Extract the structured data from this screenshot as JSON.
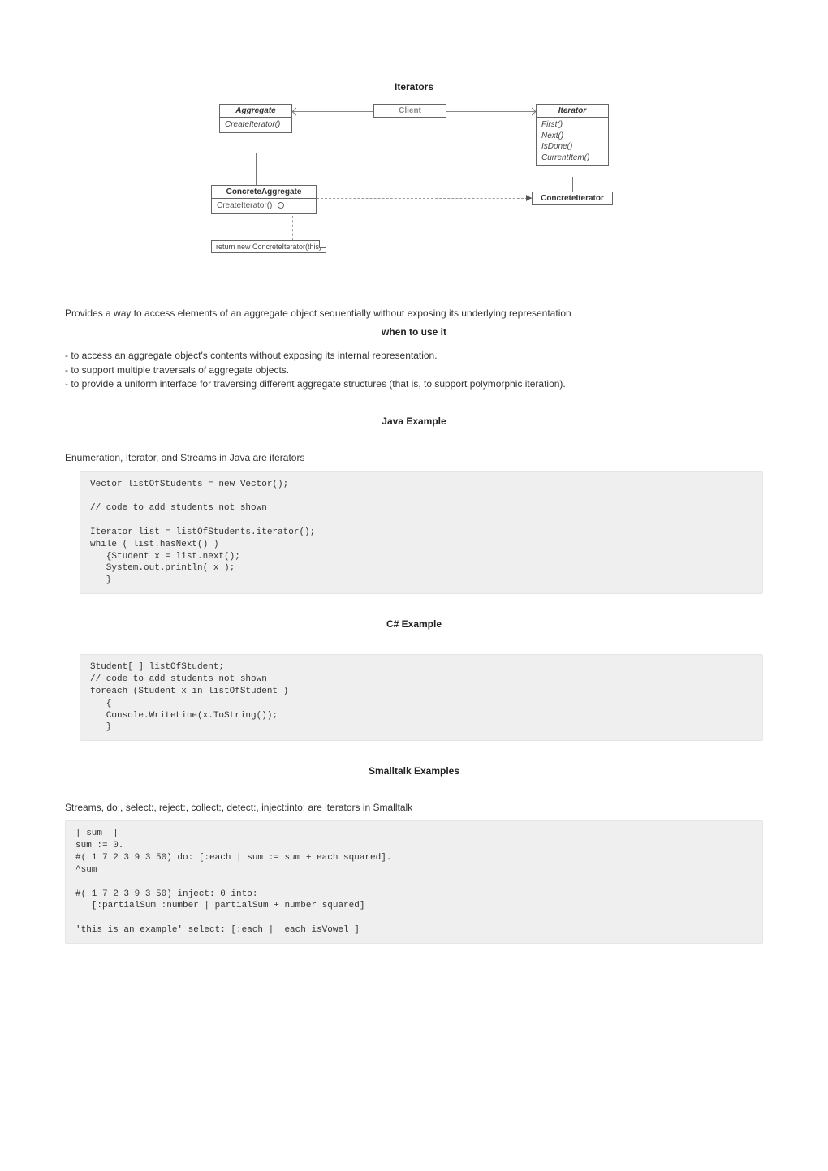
{
  "title": "Iterators",
  "diagram": {
    "aggregate": {
      "name": "Aggregate",
      "op": "CreateIterator()"
    },
    "client": {
      "name": "Client"
    },
    "iterator": {
      "name": "Iterator",
      "ops": "First()\nNext()\nIsDone()\nCurrentItem()"
    },
    "concreteAggregate": {
      "name": "ConcreteAggregate",
      "op": "CreateIterator()"
    },
    "concreteIterator": {
      "name": "ConcreteIterator"
    },
    "note": "return new ConcreteIterator(this)"
  },
  "intro": "Provides a way to access elements of an aggregate object sequentially without exposing its underlying representation",
  "whenTitle": "when to use it",
  "whenItems": [
    "- to access an aggregate object's contents without exposing its internal representation.",
    "- to support multiple traversals of aggregate objects.",
    "- to provide a uniform interface for traversing different aggregate structures (that is, to support polymorphic iteration)."
  ],
  "javaTitle": "Java Example",
  "javaIntro": "Enumeration, Iterator, and Streams in Java are iterators",
  "javaCode": "Vector listOfStudents = new Vector();\n   \n// code to add students not shown\n   \nIterator list = listOfStudents.iterator();\nwhile ( list.hasNext() )\n   {Student x = list.next();\n   System.out.println( x );\n   }",
  "csharpTitle": "C# Example",
  "csharpCode": "Student[ ] listOfStudent;\n// code to add students not shown\nforeach (Student x in listOfStudent )\n   {\n   Console.WriteLine(x.ToString());\n   }",
  "smalltalkTitle": "Smalltalk Examples",
  "smalltalkIntro": "Streams, do:, select:, reject:, collect:, detect:, inject:into: are iterators in Smalltalk",
  "smalltalkCode": "| sum  |\nsum := 0.\n#( 1 7 2 3 9 3 50) do: [:each | sum := sum + each squared].\n^sum\n   \n#( 1 7 2 3 9 3 50) inject: 0 into:\n   [:partialSum :number | partialSum + number squared]\n   \n'this is an example' select: [:each |  each isVowel ]"
}
